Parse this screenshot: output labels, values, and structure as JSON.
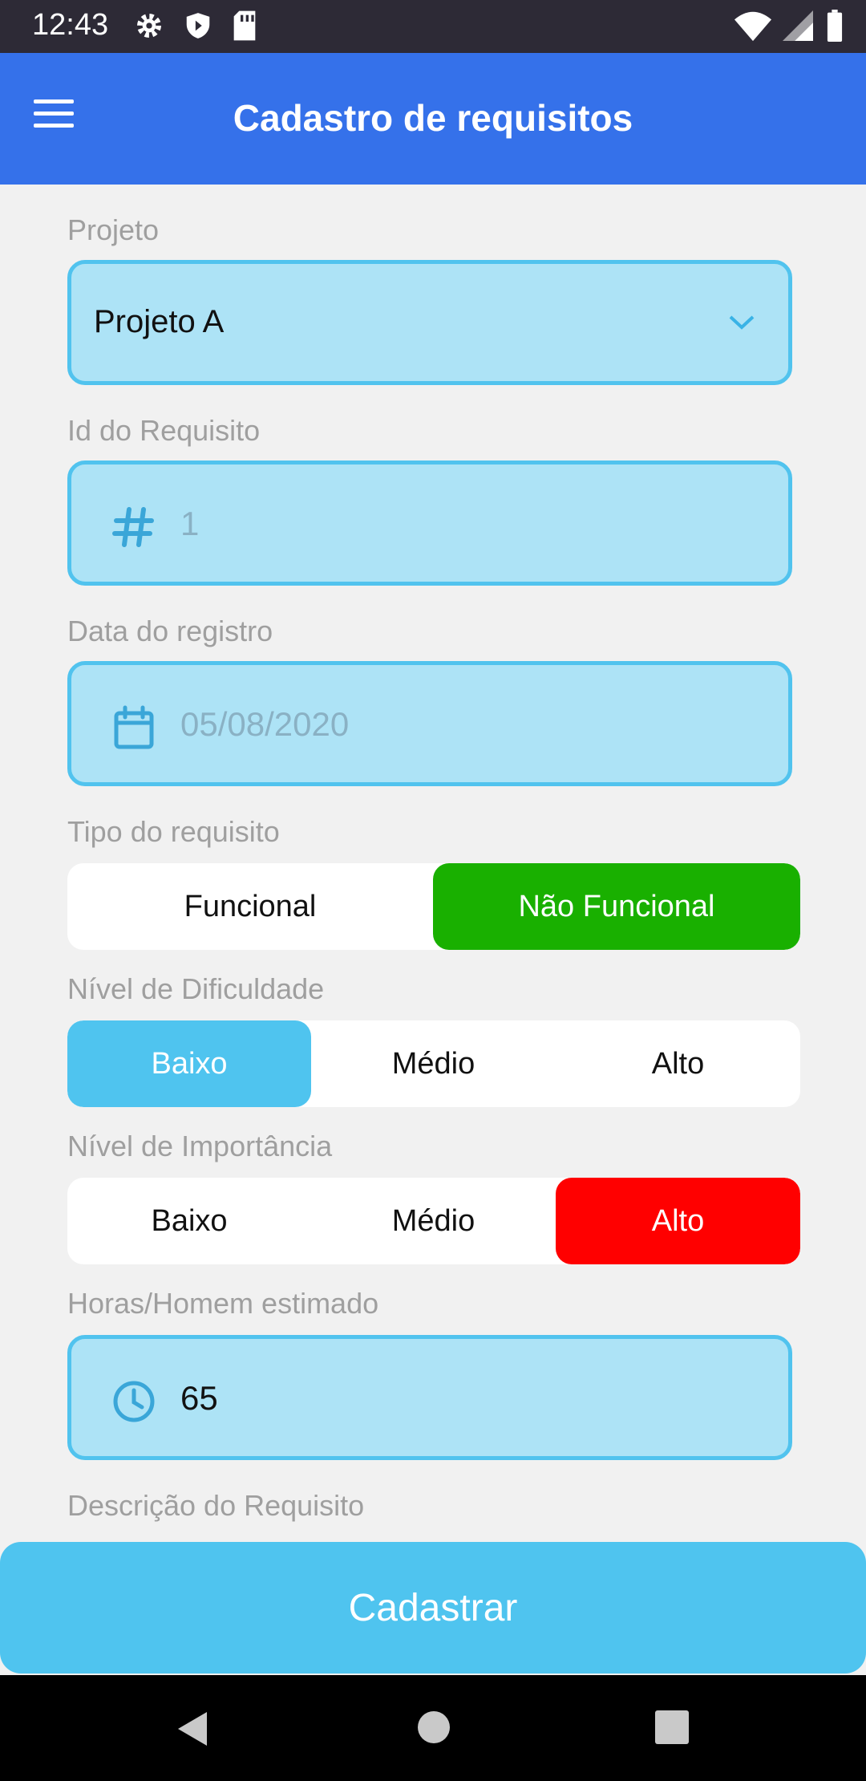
{
  "status_bar": {
    "time": "12:43",
    "icons": [
      "gear-icon",
      "shield-icon",
      "sd-card-icon",
      "wifi-icon",
      "signal-icon",
      "battery-icon"
    ]
  },
  "app_bar": {
    "title": "Cadastro de requisitos",
    "menu_icon": "menu-icon",
    "color": "#3571ea"
  },
  "form": {
    "project": {
      "label": "Projeto",
      "value": "Projeto A"
    },
    "requirement_id": {
      "label": "Id do Requisito",
      "placeholder": "1"
    },
    "registration_date": {
      "label": "Data do registro",
      "placeholder": "05/08/2020"
    },
    "requirement_type": {
      "label": "Tipo do requisito",
      "options": [
        "Funcional",
        "Não Funcional"
      ],
      "selected": "Não Funcional",
      "selected_color": "#19b000"
    },
    "difficulty": {
      "label": "Nível de Dificuldade",
      "options": [
        "Baixo",
        "Médio",
        "Alto"
      ],
      "selected": "Baixo",
      "selected_color": "#4fc4ef"
    },
    "importance": {
      "label": "Nível de Importância",
      "options": [
        "Baixo",
        "Médio",
        "Alto"
      ],
      "selected": "Alto",
      "selected_color": "#ff0000"
    },
    "estimated_hours": {
      "label": "Horas/Homem estimado",
      "value": "65"
    },
    "description": {
      "label": "Descrição do Requisito"
    }
  },
  "submit": {
    "label": "Cadastrar",
    "color": "#4fc4ef"
  },
  "navigation": {
    "icons": [
      "back-icon",
      "home-icon",
      "recents-icon"
    ]
  }
}
